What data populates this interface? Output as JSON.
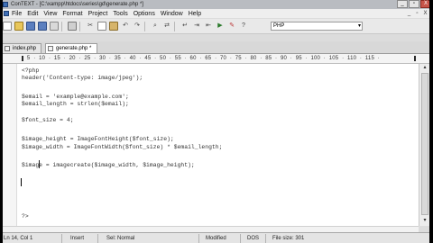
{
  "window": {
    "title": "ConTEXT - [C:\\xampp\\htdocs\\series\\gd\\generate.php *]",
    "controls": [
      "_",
      "▫",
      "X"
    ]
  },
  "menubar": {
    "items": [
      "File",
      "Edit",
      "View",
      "Format",
      "Project",
      "Tools",
      "Options",
      "Window",
      "Help"
    ],
    "controls": [
      "_",
      "▫",
      "X"
    ]
  },
  "toolbar": {
    "language": "PHP"
  },
  "tabs": [
    {
      "label": "index.php"
    },
    {
      "label": "generate.php *"
    }
  ],
  "ruler": {
    "text": "·  5  ·  10  ·  15  ·  20  ·  25  ·  30  ·  35  ·  40  ·  45  ·  50  ·  55  ·  60  ·  65  ·  70  ·  75  ·  80  ·  85  ·  90  ·  95  ·  100  ·  105  ·  110  ·  115  ·"
  },
  "code": [
    "<?php",
    "header('Content-type: image/jpeg');",
    "",
    "$email = 'example@example.com';",
    "$email_length = strlen($email);",
    "",
    "$font_size = 4;",
    "",
    "$image_height = ImageFontHeight($font_size);",
    "$image_width = ImageFontWidth($font_size) * $email_length;",
    "",
    "$image = imagecreate($image_width, $image_height);",
    "",
    "",
    "",
    "",
    "",
    "",
    "",
    "",
    "?>"
  ],
  "status": {
    "position": "Ln 14, Col 1",
    "mode": "Insert",
    "selection": "Sel: Normal",
    "state": "Modified",
    "format": "DOS",
    "filesize": "File size: 301"
  }
}
